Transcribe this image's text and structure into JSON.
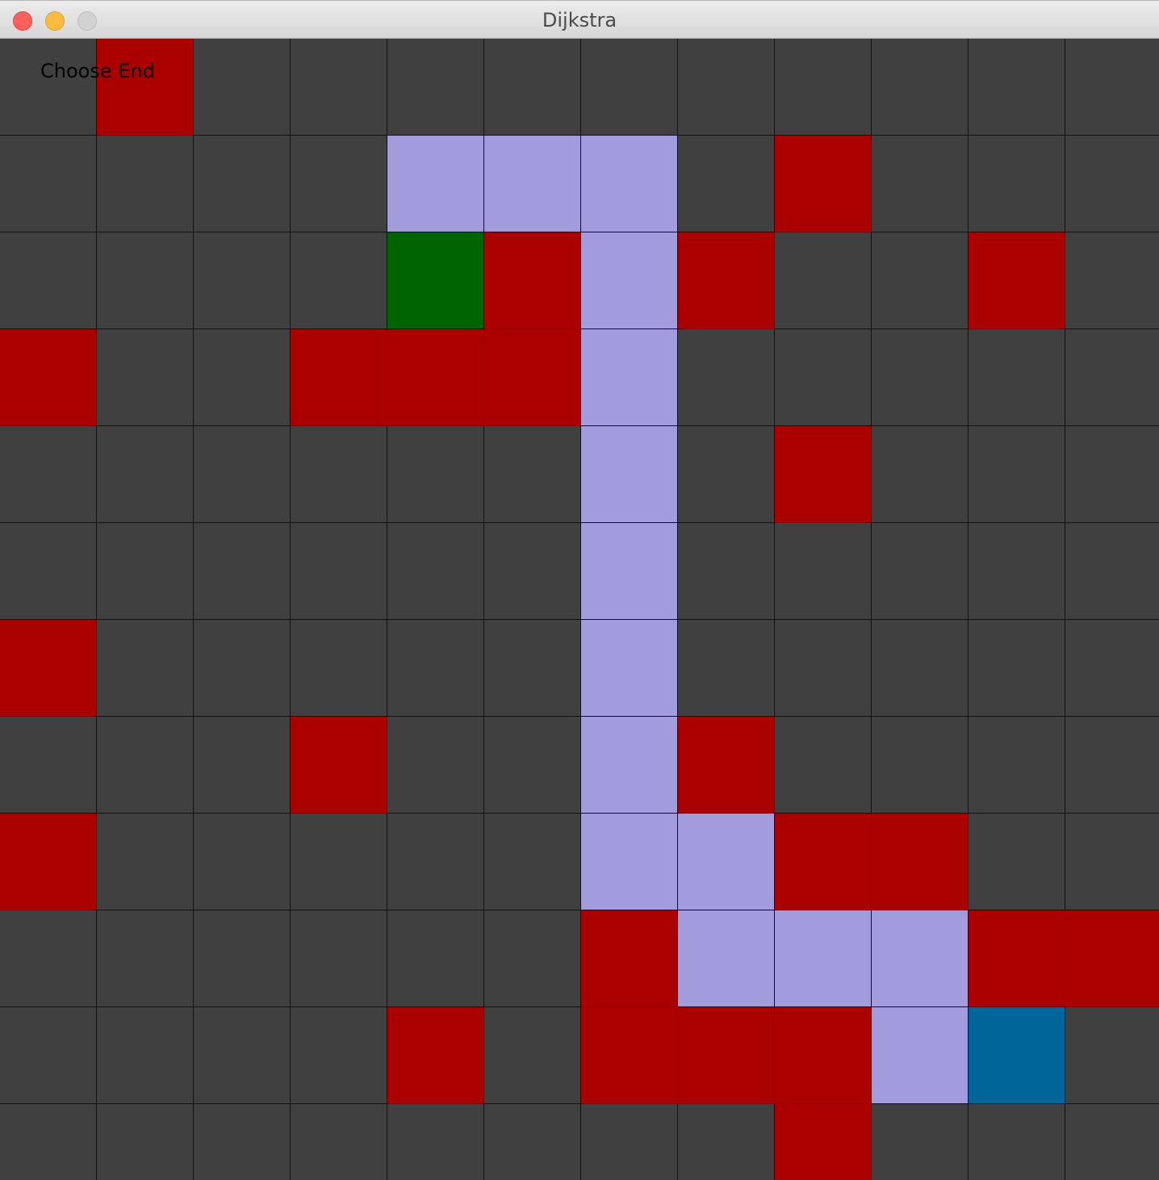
{
  "window": {
    "title": "Dijkstra"
  },
  "status": {
    "text": "Choose End"
  },
  "grid": {
    "rows": 12,
    "cols": 12,
    "colors": {
      "empty": "#404040",
      "wall": "#aa0000",
      "path": "#a29bdc",
      "start": "#006400",
      "end": "#006699"
    },
    "cells": [
      [
        "empty",
        "wall",
        "empty",
        "empty",
        "empty",
        "empty",
        "empty",
        "empty",
        "empty",
        "empty",
        "empty",
        "empty"
      ],
      [
        "empty",
        "empty",
        "empty",
        "empty",
        "path",
        "path",
        "path",
        "empty",
        "wall",
        "empty",
        "empty",
        "empty"
      ],
      [
        "empty",
        "empty",
        "empty",
        "empty",
        "start",
        "wall",
        "path",
        "wall",
        "empty",
        "empty",
        "wall",
        "empty"
      ],
      [
        "wall",
        "empty",
        "empty",
        "wall",
        "wall",
        "wall",
        "path",
        "empty",
        "empty",
        "empty",
        "empty",
        "empty"
      ],
      [
        "empty",
        "empty",
        "empty",
        "empty",
        "empty",
        "empty",
        "path",
        "empty",
        "wall",
        "empty",
        "empty",
        "empty"
      ],
      [
        "empty",
        "empty",
        "empty",
        "empty",
        "empty",
        "empty",
        "path",
        "empty",
        "empty",
        "empty",
        "empty",
        "empty"
      ],
      [
        "wall",
        "empty",
        "empty",
        "empty",
        "empty",
        "empty",
        "path",
        "empty",
        "empty",
        "empty",
        "empty",
        "empty"
      ],
      [
        "empty",
        "empty",
        "empty",
        "wall",
        "empty",
        "empty",
        "path",
        "wall",
        "empty",
        "empty",
        "empty",
        "empty"
      ],
      [
        "wall",
        "empty",
        "empty",
        "empty",
        "empty",
        "empty",
        "path",
        "path",
        "wall",
        "wall",
        "empty",
        "empty"
      ],
      [
        "empty",
        "empty",
        "empty",
        "empty",
        "empty",
        "empty",
        "wall",
        "path",
        "path",
        "path",
        "wall",
        "wall"
      ],
      [
        "empty",
        "empty",
        "empty",
        "empty",
        "wall",
        "empty",
        "wall",
        "wall",
        "wall",
        "path",
        "end",
        "empty"
      ],
      [
        "empty",
        "empty",
        "empty",
        "empty",
        "empty",
        "empty",
        "empty",
        "empty",
        "wall",
        "empty",
        "empty",
        "empty"
      ]
    ]
  }
}
